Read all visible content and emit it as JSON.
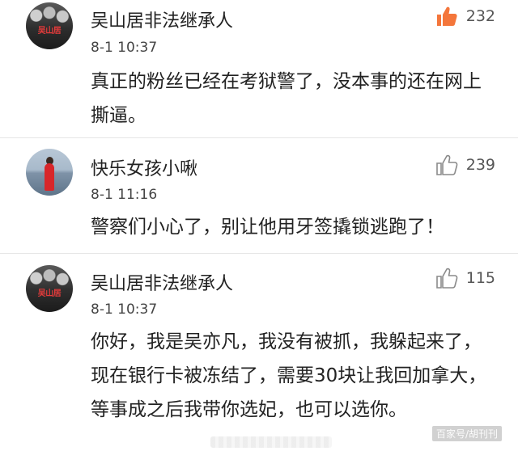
{
  "comments": [
    {
      "username": "吴山居非法继承人",
      "avatar_text": "吴山居",
      "time": "8-1 10:37",
      "text": "真正的粉丝已经在考狱警了，没本事的还在网上撕逼。",
      "likes": "232",
      "liked": true
    },
    {
      "username": "快乐女孩小啾",
      "time": "8-1 11:16",
      "text": "警察们小心了，别让他用牙签撬锁逃跑了！",
      "likes": "239",
      "liked": false
    },
    {
      "username": "吴山居非法继承人",
      "avatar_text": "吴山居",
      "time": "8-1 10:37",
      "text": "你好，我是吴亦凡，我没有被抓，我躲起来了，现在银行卡被冻结了，需要30块让我回加拿大，等事成之后我带你选妃，也可以选你。",
      "likes": "115",
      "liked": false
    }
  ],
  "watermark": "百家号/胡刊刊",
  "colors": {
    "like_active": "#f4763b",
    "like_inactive": "#8a8a8a",
    "divider": "#e6e6e6"
  },
  "icons": {
    "like": "thumbs-up-icon"
  }
}
